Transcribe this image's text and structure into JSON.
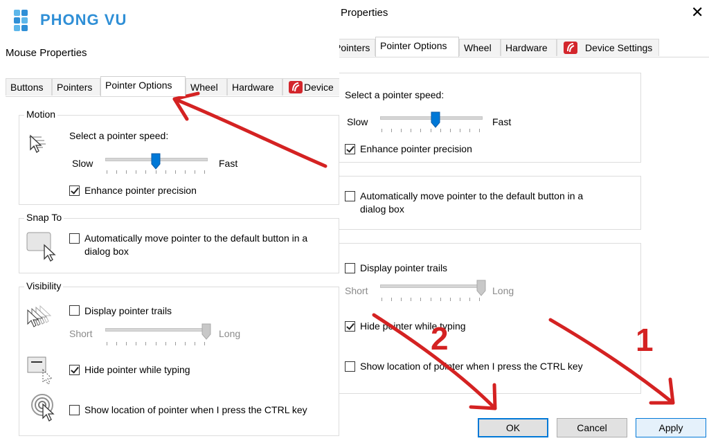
{
  "brand": {
    "name": "PHONG VU"
  },
  "left": {
    "window_title": "Mouse Properties",
    "tabs": [
      "Buttons",
      "Pointers",
      "Pointer Options",
      "Wheel",
      "Hardware",
      "Device"
    ],
    "active_tab": "Pointer Options",
    "motion": {
      "label": "Motion",
      "speed_label": "Select a pointer speed:",
      "slow": "Slow",
      "fast": "Fast",
      "speed_level": 0.5,
      "precision_label": "Enhance pointer precision",
      "precision_checked": true
    },
    "snap": {
      "label": "Snap To",
      "text_line1": "Automatically move pointer to the default button in a",
      "text_line2": "dialog box",
      "checked": false
    },
    "visibility": {
      "label": "Visibility",
      "trails_label": "Display pointer trails",
      "trails_checked": false,
      "short": "Short",
      "long": "Long",
      "trails_level": 1.0,
      "hide_label": "Hide pointer while typing",
      "hide_checked": true,
      "ctrl_label": "Show location of pointer when I press the CTRL key",
      "ctrl_checked": false
    }
  },
  "right": {
    "window_title": "Properties",
    "tabs": [
      "Pointers",
      "Pointer Options",
      "Wheel",
      "Hardware",
      "Device Settings"
    ],
    "active_tab": "Pointer Options",
    "speed_label": "Select a pointer speed:",
    "slow": "Slow",
    "fast": "Fast",
    "speed_level": 0.55,
    "precision_label": "Enhance pointer precision",
    "precision_checked": true,
    "snap_line1": "Automatically move pointer to the default button in a",
    "snap_line2": "dialog box",
    "trails_label": "Display pointer trails",
    "short": "Short",
    "long": "Long",
    "trails_level": 1.0,
    "hide_label": "Hide pointer while typing",
    "hide_checked": true,
    "ctrl_label": "Show location of pointer when I press the CTRL key",
    "buttons": {
      "ok": "OK",
      "cancel": "Cancel",
      "apply": "Apply"
    }
  },
  "annotations": {
    "mark_ok": "2",
    "mark_apply": "1",
    "color": "#d42222"
  },
  "icons": [
    "phong-vu-logo-icon",
    "close-icon",
    "device-settings-icon",
    "pointer-speed-icon",
    "snap-to-icon",
    "pointer-trails-icon",
    "hide-pointer-icon",
    "ctrl-location-icon"
  ]
}
